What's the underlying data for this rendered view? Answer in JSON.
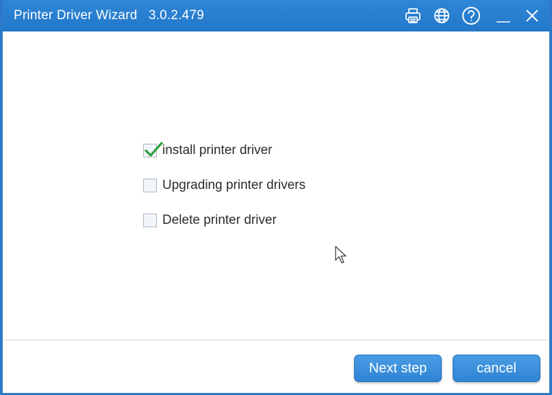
{
  "window": {
    "title": "Printer Driver Wizard",
    "version": "3.0.2.479"
  },
  "titlebar_buttons": [
    {
      "icon": "printer-icon"
    },
    {
      "icon": "globe-icon"
    },
    {
      "icon": "help-icon"
    },
    {
      "icon": "minimize-icon"
    },
    {
      "icon": "close-icon"
    }
  ],
  "options": [
    {
      "label": "install printer driver",
      "checked": true
    },
    {
      "label": "Upgrading printer drivers",
      "checked": false
    },
    {
      "label": "Delete printer driver",
      "checked": false
    }
  ],
  "footer": {
    "next_label": "Next step",
    "cancel_label": "cancel"
  },
  "colors": {
    "accent": "#2277c9",
    "check": "#2e9e3a"
  }
}
